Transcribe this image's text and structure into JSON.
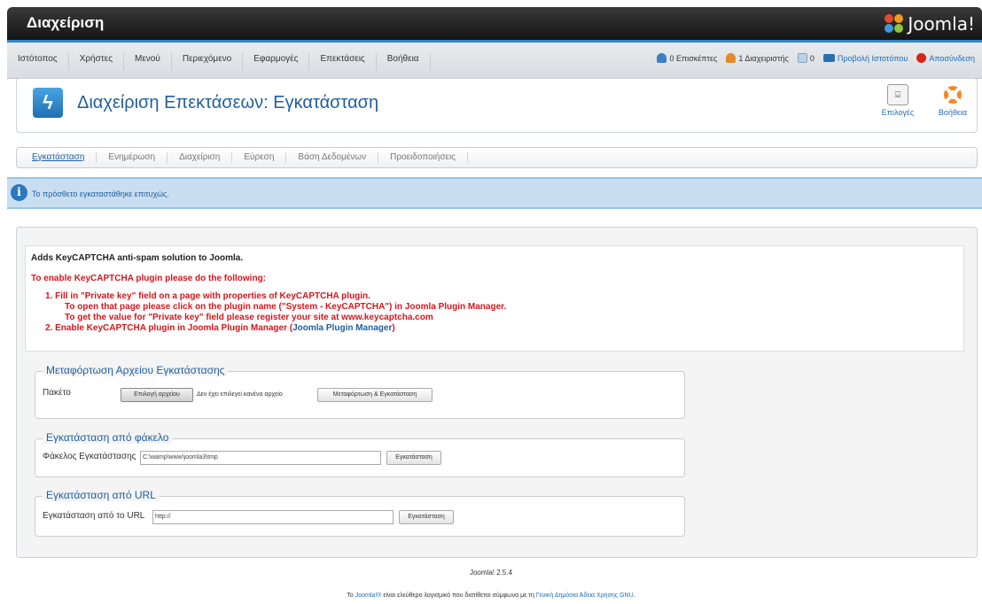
{
  "header": {
    "title": "Διαχείριση",
    "logo_text": "Joomla!"
  },
  "menu": {
    "items": [
      "Ιστότοπος",
      "Χρήστες",
      "Μενού",
      "Περιεχόμενο",
      "Εφαρμογές",
      "Επεκτάσεις",
      "Βοήθεια"
    ],
    "status": {
      "visitors": "0 Επισκέπτες",
      "admins": "1 Διαχειριστής",
      "messages": "0",
      "view_site": "Προβολή Ιστοτόπου",
      "logout": "Αποσύνδεση"
    }
  },
  "toolbar": {
    "title": "Διαχείριση Επεκτάσεων: Εγκατάσταση",
    "options_label": "Επιλογές",
    "help_label": "Βοήθεια"
  },
  "submenu": {
    "items": [
      "Εγκατάσταση",
      "Ενημέρωση",
      "Διαχείριση",
      "Εύρεση",
      "Βάση Δεδομένων",
      "Προειδοποιήσεις"
    ]
  },
  "message": {
    "text": "Το πρόσθετο εγκαταστάθηκε επιτυχώς."
  },
  "description": {
    "title": "Adds KeyCAPTCHA anti-spam solution to Joomla.",
    "intro": "To enable KeyCAPTCHA plugin please do the following:",
    "line1": "1.  Fill in \"Private key\" field on a page with properties of KeyCAPTCHA plugin.",
    "line2": "To open that page please click on the plugin name (\"System - KeyCAPTCHA\") in Joomla Plugin Manager.",
    "line3": "To get the value for \"Private key\" field please register your site at www.keycaptcha.com",
    "line4_prefix": "2.  Enable KeyCAPTCHA plugin in Joomla Plugin Manager (",
    "line4_link": "Joomla Plugin Manager",
    "line4_suffix": ")"
  },
  "upload": {
    "legend": "Μεταφόρτωση Αρχείου Εγκατάστασης",
    "label": "Πακέτο",
    "choose_button": "Επιλογή αρχείου",
    "no_file": "Δεν έχει επιλεγεί κανένα αρχείο",
    "submit_button": "Μεταφόρτωση & Εγκατάσταση"
  },
  "folder": {
    "legend": "Εγκατάσταση από φάκελο",
    "label": "Φάκελος Εγκατάστασης",
    "value": "C:\\wamp\\www\\joomla3\\tmp",
    "button": "Εγκατάσταση"
  },
  "url": {
    "legend": "Εγκατάσταση από URL",
    "label": "Εγκατάσταση από το URL",
    "value": "http://",
    "button": "Εγκατάσταση"
  },
  "footer": {
    "version": "Joomla! 2.5.4",
    "license_prefix": "Το ",
    "license_link1": "Joomla!®",
    "license_middle": " είναι ελεύθερο λογισμικό που διατίθεται σύμφωνα με τη ",
    "license_link2": "Γενική Δημόσια Άδεια Χρήσης GNU",
    "license_suffix": "."
  }
}
